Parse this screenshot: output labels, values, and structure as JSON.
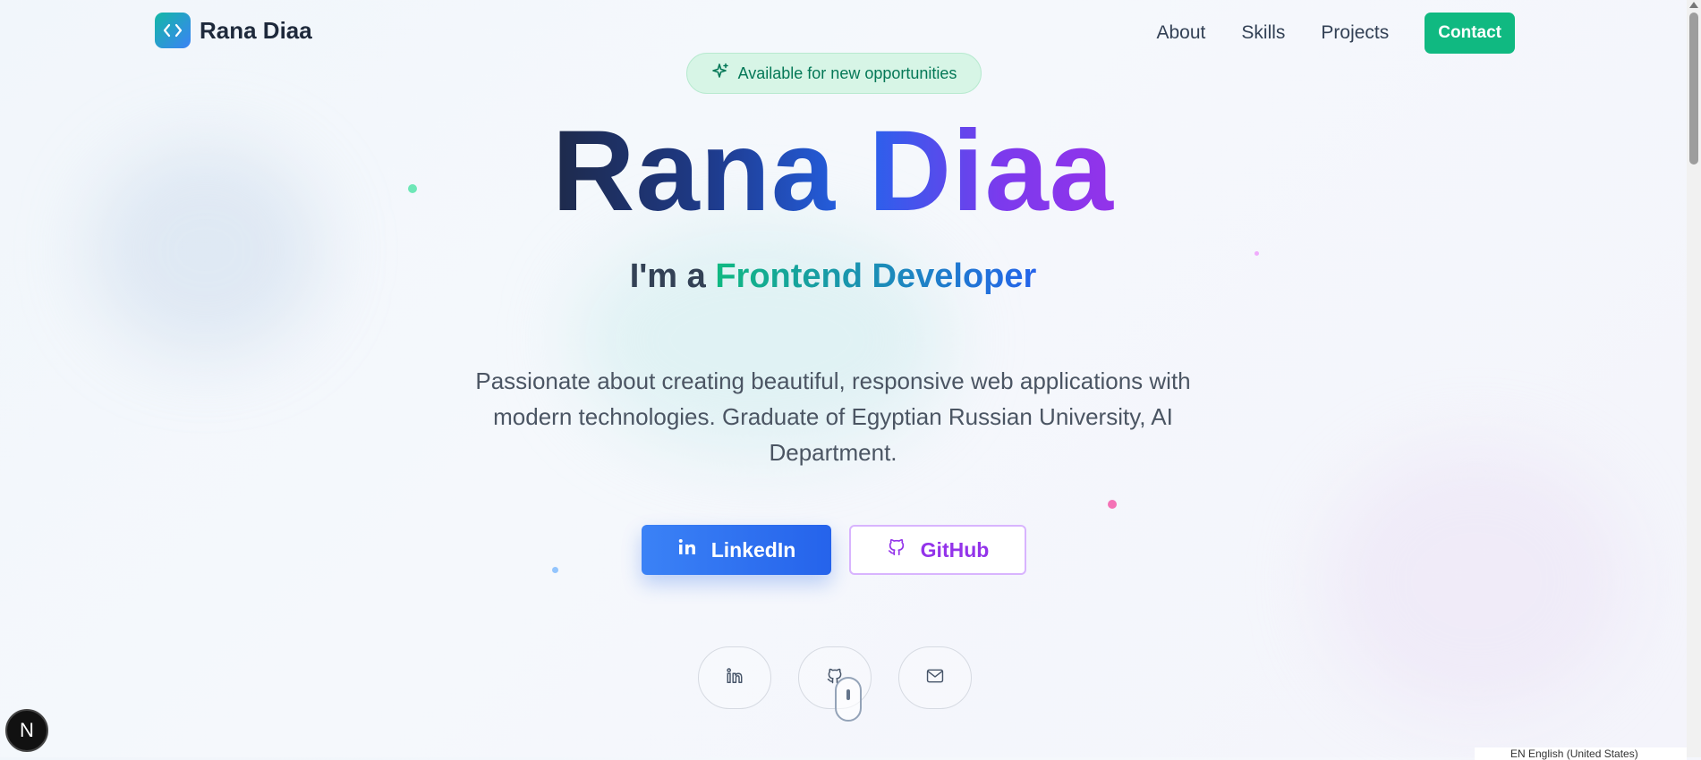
{
  "header": {
    "brand_name": "Rana Diaa",
    "nav": [
      "About",
      "Skills",
      "Projects"
    ],
    "contact_label": "Contact"
  },
  "hero": {
    "badge_text": "Available for new opportunities",
    "name": "Rana Diaa",
    "subtitle_prefix": "I'm a",
    "role": "Frontend Developer",
    "description": "Passionate about creating beautiful, responsive web applications with modern technologies. Graduate of Egyptian Russian University, AI Department.",
    "buttons": {
      "linkedin": "LinkedIn",
      "github": "GitHub"
    },
    "socials": [
      "linkedin-icon",
      "github-icon",
      "mail-icon"
    ]
  },
  "colors": {
    "accent_green": "#10b981",
    "accent_blue": "#2563eb",
    "accent_purple": "#9333ea"
  },
  "overlay": {
    "dev_badge": "N",
    "language_indicator": "EN English (United States)"
  }
}
